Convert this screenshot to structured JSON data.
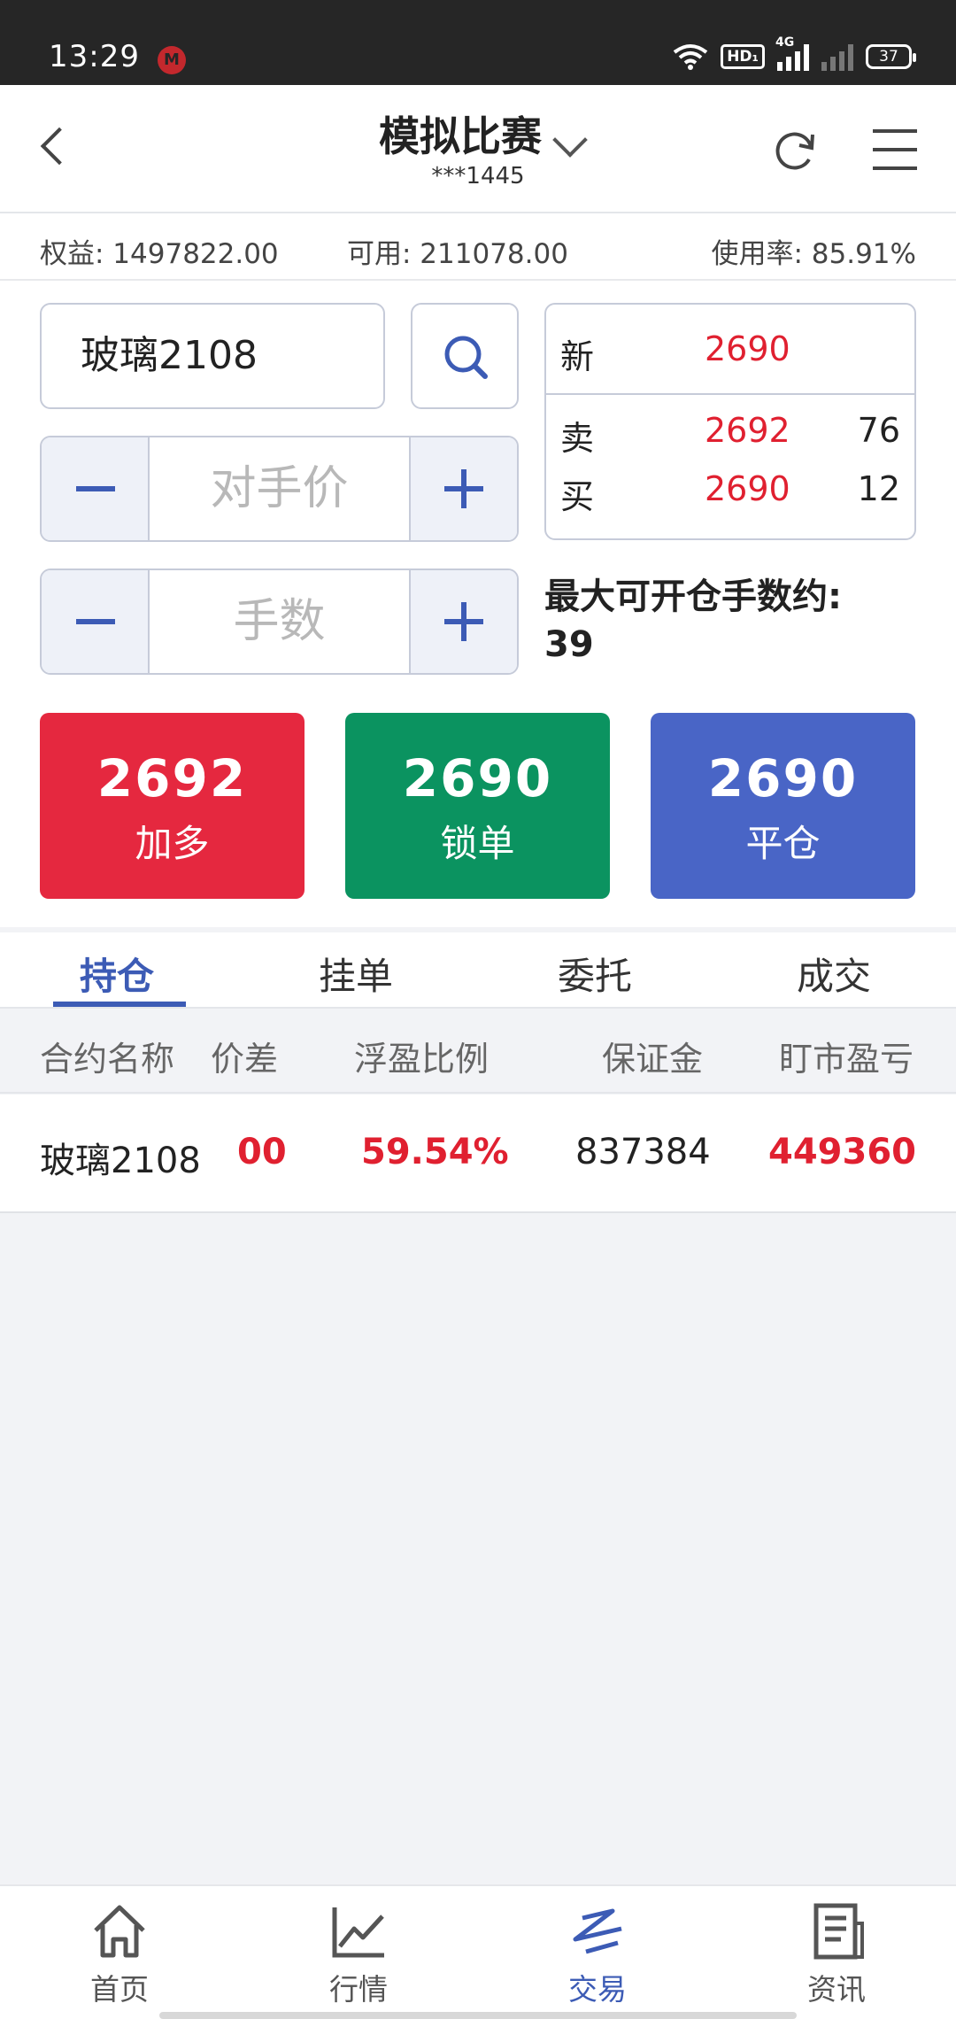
{
  "status_bar": {
    "time": "13:29",
    "app_icon": "app-notification-icon",
    "hd": "HD₁",
    "network": "4G",
    "battery": "37"
  },
  "header": {
    "title": "模拟比赛",
    "account": "***1445"
  },
  "account_summary": {
    "equity": "权益: 1497822.00",
    "available": "可用: 211078.00",
    "usage": "使用率: 85.91%"
  },
  "order_form": {
    "contract": "玻璃2108",
    "price_placeholder": "对手价",
    "quantity_placeholder": "手数",
    "max_open_label": "最大可开仓手数约:",
    "max_open_value": "39"
  },
  "quote": {
    "last_label": "新",
    "last_price": "2690",
    "ask_label": "卖",
    "ask_price": "2692",
    "ask_volume": "76",
    "bid_label": "买",
    "bid_price": "2690",
    "bid_volume": "12"
  },
  "actions": {
    "buy_price": "2692",
    "buy_label": "加多",
    "lock_price": "2690",
    "lock_label": "锁单",
    "close_price": "2690",
    "close_label": "平仓"
  },
  "tabs": [
    "持仓",
    "挂单",
    "委托",
    "成交"
  ],
  "positions": {
    "columns": [
      "合约名称",
      "价差",
      "浮盈比例",
      "保证金",
      "盯市盈亏"
    ],
    "rows": [
      [
        "玻璃2108",
        "00",
        "59.54%",
        "837384",
        "449360"
      ]
    ]
  },
  "bottom_nav": [
    "首页",
    "行情",
    "交易",
    "资讯"
  ],
  "colors": {
    "accent": "#3c5bb5",
    "buy": "#e5283f",
    "lock": "#0b9360",
    "close": "#4965c6",
    "up": "#e02030"
  }
}
